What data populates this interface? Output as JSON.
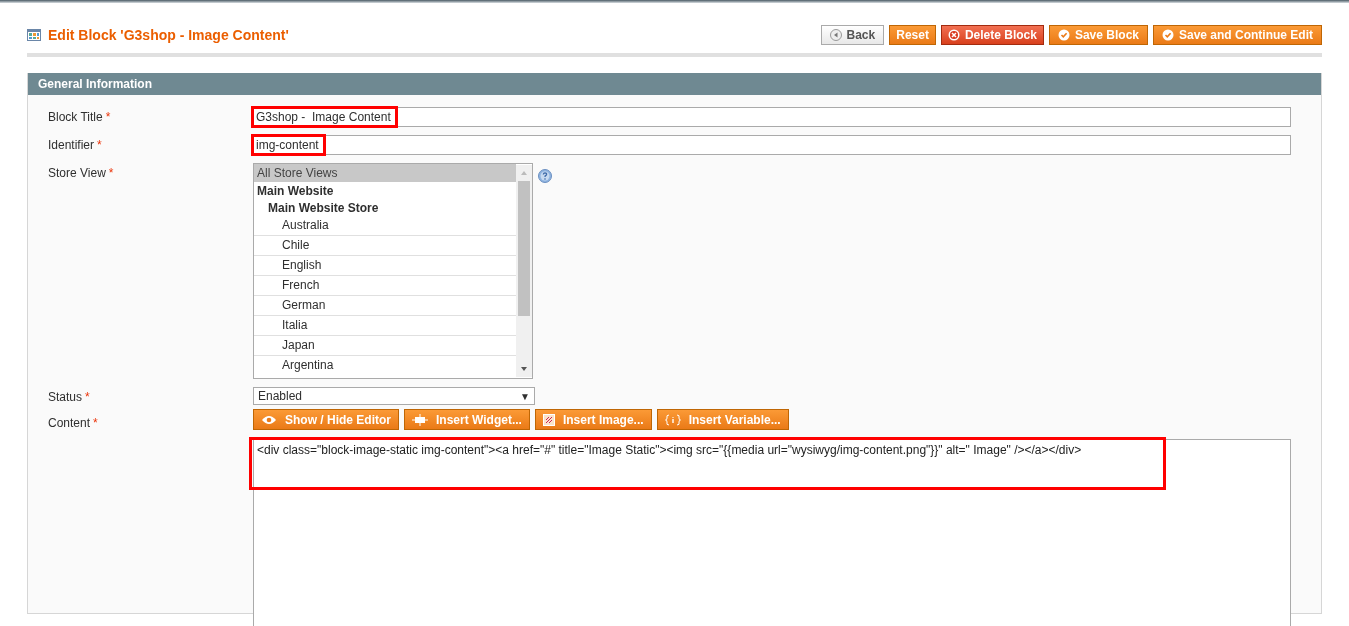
{
  "page_title": "Edit Block 'G3shop - Image Content'",
  "buttons": [
    {
      "label": "Back",
      "kind": "back"
    },
    {
      "label": "Reset",
      "kind": "plain"
    },
    {
      "label": "Delete Block",
      "kind": "delete"
    },
    {
      "label": "Save Block",
      "kind": "save"
    },
    {
      "label": "Save and Continue Edit",
      "kind": "save"
    }
  ],
  "section": {
    "title": "General Information"
  },
  "fields": [
    {
      "label": "Block Title",
      "required": "*",
      "value": "G3shop -  Image Content",
      "highlighted": true
    },
    {
      "label": "Identifier",
      "required": "*",
      "value": "img-content",
      "highlighted": true
    }
  ],
  "store_view": {
    "label": "Store View",
    "required": "*",
    "options": [
      {
        "label": "All Store Views",
        "selected": true
      },
      {
        "label": "Main Website",
        "selected": false,
        "children": [
          {
            "label": "Main Website Store",
            "selected": false,
            "children": [
              {
                "label": "Australia",
                "selected": false
              },
              {
                "label": "Chile",
                "selected": false
              },
              {
                "label": "English",
                "selected": false
              },
              {
                "label": "French",
                "selected": false
              },
              {
                "label": "German",
                "selected": false
              },
              {
                "label": "Italia",
                "selected": false
              },
              {
                "label": "Japan",
                "selected": false
              },
              {
                "label": "Argentina",
                "selected": false
              }
            ]
          }
        ]
      }
    ]
  },
  "status": {
    "label": "Status",
    "required": "*",
    "value": "Enabled",
    "arrow": "▼"
  },
  "content": {
    "label": "Content",
    "required": "*",
    "toolbar": [
      {
        "label": "Show / Hide Editor",
        "kind": "eye"
      },
      {
        "label": "Insert Widget...",
        "kind": "widget"
      },
      {
        "label": "Insert Image...",
        "kind": "image"
      },
      {
        "label": "Insert Variable...",
        "kind": "variable"
      }
    ],
    "value": "<div class=\"block-image-static img-content\"><a href=\"#\" title=\"Image Static\"><img src=\"{{media url=\"wysiwyg/img-content.png\"}}\" alt=\" Image\" /></a></div>",
    "highlighted": true
  }
}
